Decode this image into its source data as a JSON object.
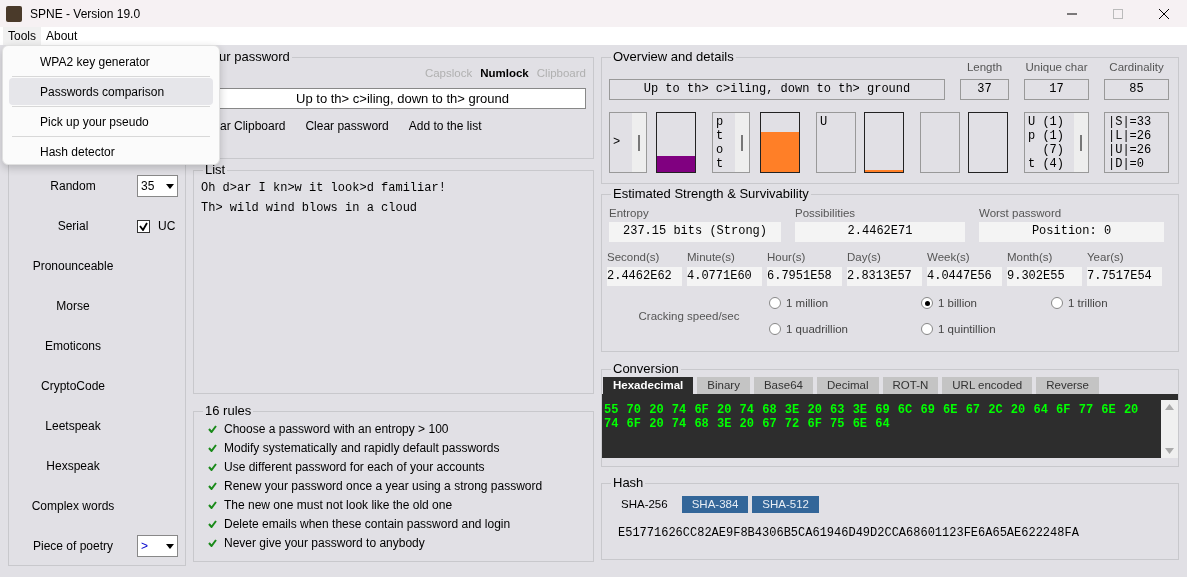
{
  "window": {
    "title": "SPNE - Version 19.0"
  },
  "menu_bar": [
    {
      "label": "Tools",
      "selected": true
    },
    {
      "label": "About",
      "selected": false
    }
  ],
  "tools_menu": [
    {
      "label": "WPA2 key generator",
      "selected": false
    },
    {
      "label": "Passwords comparison",
      "selected": true
    },
    {
      "label": "Pick up your pseudo",
      "selected": false
    },
    {
      "label": "Hash detector",
      "selected": false
    }
  ],
  "generators": [
    {
      "label": "Random",
      "kind": "select",
      "value": "35"
    },
    {
      "label": "Serial",
      "kind": "checkbox",
      "option": "UC",
      "checked": true
    },
    {
      "label": "Pronounceable",
      "kind": "plain"
    },
    {
      "label": "Morse",
      "kind": "plain"
    },
    {
      "label": "Emoticons",
      "kind": "plain"
    },
    {
      "label": "CryptoCode",
      "kind": "plain"
    },
    {
      "label": "Leetspeak",
      "kind": "plain"
    },
    {
      "label": "Hexspeak",
      "kind": "plain"
    },
    {
      "label": "Complex words",
      "kind": "plain"
    },
    {
      "label": "Piece of poetry",
      "kind": "select",
      "value": ">"
    }
  ],
  "password": {
    "title": "ur password",
    "indicators": [
      {
        "label": "Capslock",
        "on": false
      },
      {
        "label": "Numlock",
        "on": true
      },
      {
        "label": "Clipboard",
        "on": false
      }
    ],
    "value": "Up to th> c>iling, down to th> ground",
    "buttons": [
      "ar Clipboard",
      "Clear password",
      "Add to the list"
    ]
  },
  "list": {
    "title": "List",
    "items": [
      "Oh d>ar I kn>w it look>d familiar!",
      "Th> wild wind blows in a cloud"
    ]
  },
  "rules": {
    "title": "16 rules",
    "items": [
      "Choose a password with an entropy > 100",
      "Modify systematically and rapidly default passwords",
      "Use different password for each of your accounts",
      "Renew your password once a year using a strong password",
      "The new one must not look like the old one",
      "Delete emails when these contain password and login",
      "Never give your password to anybody"
    ]
  },
  "overview": {
    "title": "Overview and details",
    "password": "Up to th> c>iling, down to th> ground",
    "stats": [
      {
        "label": "Length",
        "value": "37"
      },
      {
        "label": "Unique char",
        "value": "17"
      },
      {
        "label": "Cardinality",
        "value": "85"
      }
    ],
    "panels": [
      {
        "kind": "list",
        "lines": [
          ">"
        ]
      },
      {
        "kind": "gauge",
        "level": 0.28,
        "color": "#800080"
      },
      {
        "kind": "list",
        "lines": [
          "p",
          "t",
          "o",
          "t"
        ]
      },
      {
        "kind": "gauge",
        "level": 0.68,
        "color": "#ff7f27"
      },
      {
        "kind": "text",
        "lines": [
          "U"
        ]
      },
      {
        "kind": "gauge",
        "level": 0.03,
        "color": "#ff7f27"
      },
      {
        "kind": "text"
      },
      {
        "kind": "gauge"
      },
      {
        "kind": "list",
        "lines": [
          "U (1)",
          "p (1)",
          "  (7)",
          "t (4)"
        ]
      },
      {
        "kind": "text",
        "lines": [
          "|S|=33",
          "|L|=26",
          "|U|=26",
          "|D|=0"
        ]
      }
    ]
  },
  "strength": {
    "title": "Estimated Strength & Survivability",
    "summary": [
      {
        "label": "Entropy",
        "value": "237.15 bits (Strong)"
      },
      {
        "label": "Possibilities",
        "value": "2.4462E71"
      },
      {
        "label": "Worst password",
        "value": "Position: 0"
      }
    ],
    "times": [
      {
        "label": "Second(s)",
        "value": "2.4462E62"
      },
      {
        "label": "Minute(s)",
        "value": "4.0771E60"
      },
      {
        "label": "Hour(s)",
        "value": "6.7951E58"
      },
      {
        "label": "Day(s)",
        "value": "2.8313E57"
      },
      {
        "label": "Week(s)",
        "value": "4.0447E56"
      },
      {
        "label": "Month(s)",
        "value": "9.302E55"
      },
      {
        "label": "Year(s)",
        "value": "7.7517E54"
      }
    ],
    "speed": {
      "label": "Cracking speed/sec",
      "options": [
        {
          "label": "1 million",
          "selected": false
        },
        {
          "label": "1 billion",
          "selected": true
        },
        {
          "label": "1 trillion",
          "selected": false
        },
        {
          "label": "1 quadrillion",
          "selected": false
        },
        {
          "label": "1 quintillion",
          "selected": false
        }
      ]
    }
  },
  "conversion": {
    "title": "Conversion",
    "tabs": [
      {
        "label": "Hexadecimal",
        "selected": true
      },
      {
        "label": "Binary",
        "selected": false
      },
      {
        "label": "Base64",
        "selected": false
      },
      {
        "label": "Decimal",
        "selected": false
      },
      {
        "label": "ROT-N",
        "selected": false
      },
      {
        "label": "URL encoded",
        "selected": false
      },
      {
        "label": "Reverse",
        "selected": false
      }
    ],
    "output": "55 70 20 74 6F 20 74 68 3E 20 63 3E 69 6C 69 6E 67 2C 20 64 6F 77 6E 20 74 6F 20 74 68 3E 20 67 72 6F 75 6E 64"
  },
  "hash": {
    "title": "Hash",
    "algorithms": [
      {
        "label": "SHA-256",
        "selected": true
      },
      {
        "label": "SHA-384",
        "selected": false
      },
      {
        "label": "SHA-512",
        "selected": false
      }
    ],
    "value": "E51771626CC82AE9F8B4306B5CA61946D49D2CCA68601123FE6A65AE622248FA"
  }
}
